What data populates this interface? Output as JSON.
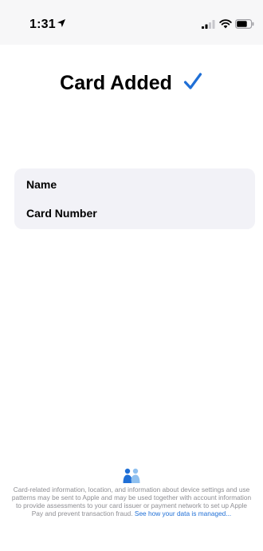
{
  "status_bar": {
    "time": "1:31"
  },
  "header": {
    "title": "Card Added"
  },
  "card": {
    "name_label": "Name",
    "number_label": "Card Number"
  },
  "footer": {
    "text": "Card-related information, location, and information about device settings and use patterns may be sent to Apple and may be used together with account information to provide assessments to your card issuer or payment network to set up Apple Pay and prevent transaction fraud. ",
    "link_text": "See how your data is managed..."
  },
  "colors": {
    "accent": "#1f6fd6",
    "card_bg": "#f2f2f7",
    "footer_text": "#8e8e93"
  },
  "icons": {
    "location": "location-arrow-icon",
    "signal": "cellular-signal-icon",
    "wifi": "wifi-icon",
    "battery": "battery-icon",
    "check": "checkmark-icon",
    "privacy": "privacy-handshake-icon"
  }
}
